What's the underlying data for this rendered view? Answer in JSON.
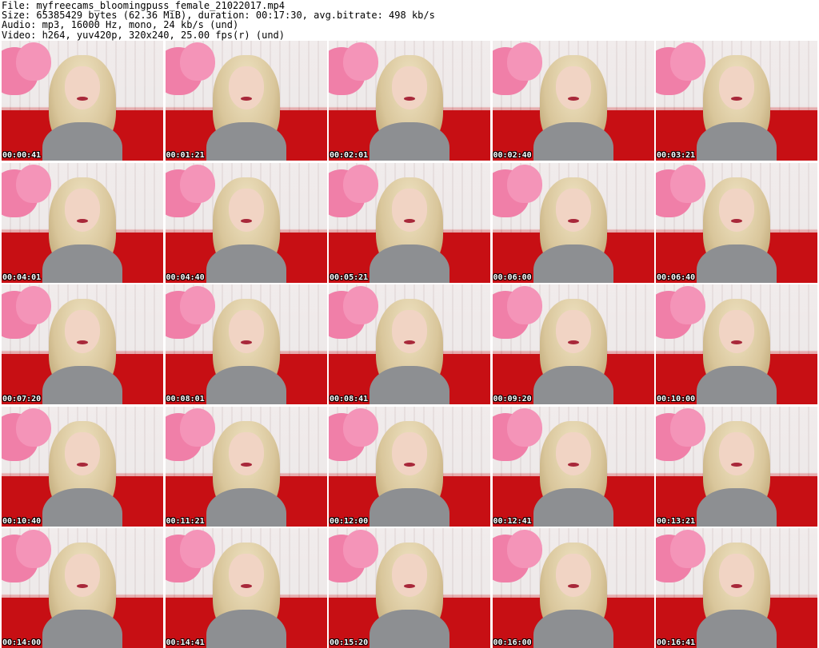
{
  "header": {
    "file_line": "File: myfreecams_bloomingpuss_female_21022017.mp4",
    "size_line": "Size: 65385429 bytes (62.36 MiB), duration: 00:17:30, avg.bitrate: 498 kb/s",
    "audio_line": "Audio: mp3, 16000 Hz, mono, 24 kb/s (und)",
    "video_line": "Video: h264, yuv420p, 320x240, 25.00 fps(r) (und)"
  },
  "thumbnails": [
    {
      "timestamp": "00:00:41"
    },
    {
      "timestamp": "00:01:21"
    },
    {
      "timestamp": "00:02:01"
    },
    {
      "timestamp": "00:02:40"
    },
    {
      "timestamp": "00:03:21"
    },
    {
      "timestamp": "00:04:01"
    },
    {
      "timestamp": "00:04:40"
    },
    {
      "timestamp": "00:05:21"
    },
    {
      "timestamp": "00:06:00"
    },
    {
      "timestamp": "00:06:40"
    },
    {
      "timestamp": "00:07:20"
    },
    {
      "timestamp": "00:08:01"
    },
    {
      "timestamp": "00:08:41"
    },
    {
      "timestamp": "00:09:20"
    },
    {
      "timestamp": "00:10:00"
    },
    {
      "timestamp": "00:10:40"
    },
    {
      "timestamp": "00:11:21"
    },
    {
      "timestamp": "00:12:00"
    },
    {
      "timestamp": "00:12:41"
    },
    {
      "timestamp": "00:13:21"
    },
    {
      "timestamp": "00:14:00"
    },
    {
      "timestamp": "00:14:41"
    },
    {
      "timestamp": "00:15:20"
    },
    {
      "timestamp": "00:16:00"
    },
    {
      "timestamp": "00:16:41"
    }
  ]
}
